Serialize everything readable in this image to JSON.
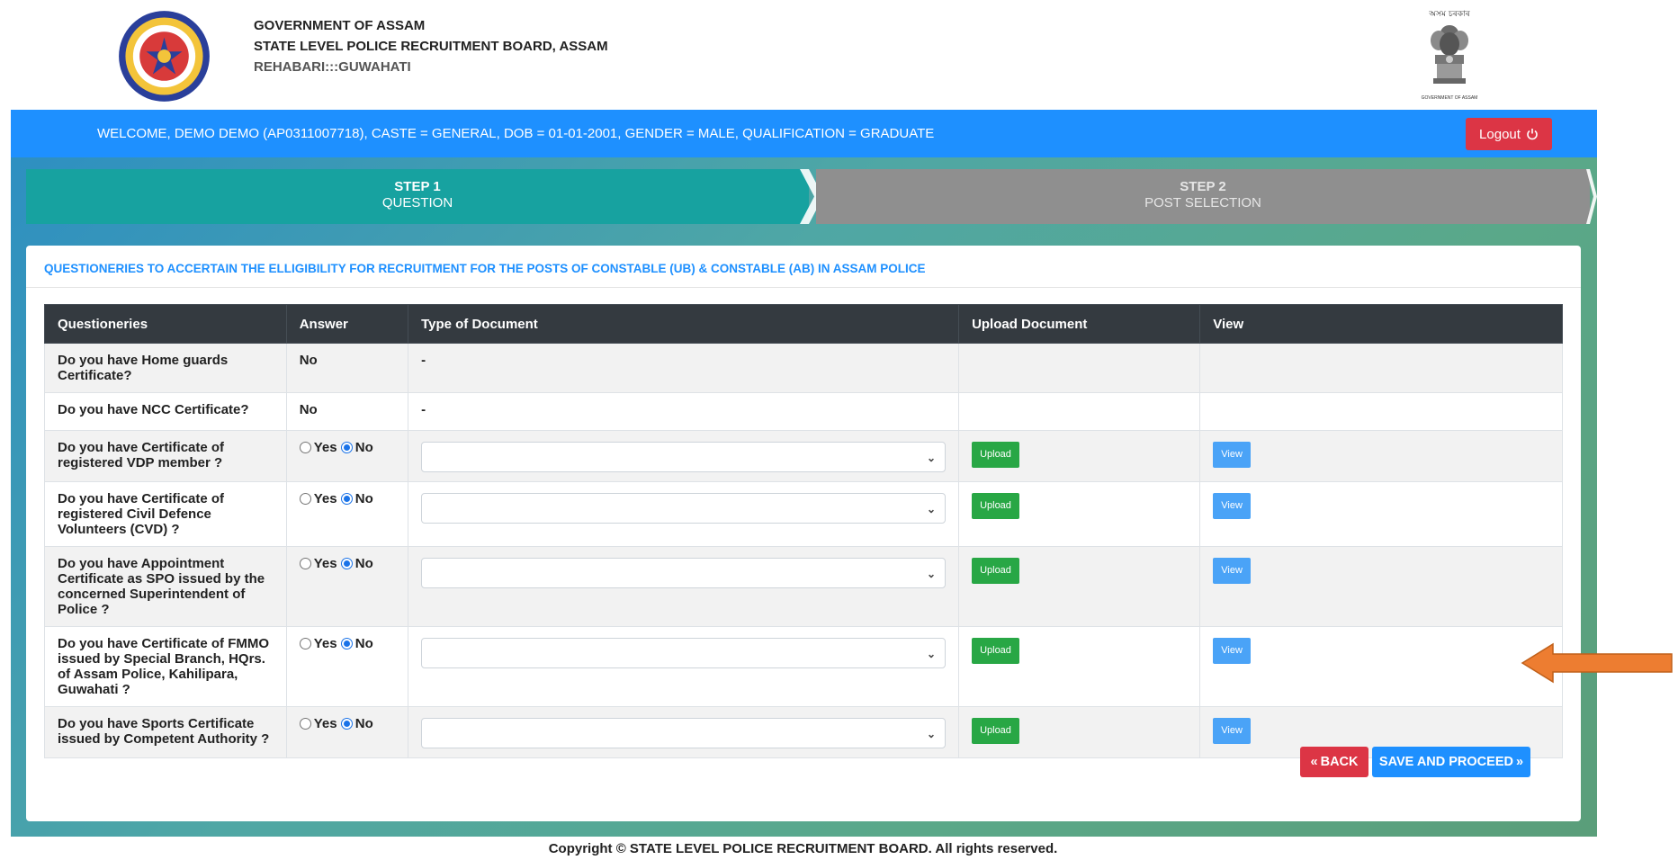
{
  "header": {
    "line1": "GOVERNMENT OF ASSAM",
    "line2": "STATE LEVEL POLICE RECRUITMENT BOARD, ASSAM",
    "line3": "REHABARI:::GUWAHATI",
    "emblem_top_text": "অসম চৰকাৰ",
    "emblem_bottom_text": "GOVERNMENT OF ASSAM",
    "logo_icon": "assam-police-logo",
    "emblem_icon": "national-emblem"
  },
  "welcome": {
    "text": "WELCOME, DEMO DEMO (AP0311007718), CASTE = GENERAL, DOB = 01-01-2001, GENDER = MALE, QUALIFICATION = GRADUATE",
    "logout_label": "Logout",
    "logout_icon": "power-icon"
  },
  "steps": [
    {
      "title": "STEP 1",
      "subtitle": "QUESTION"
    },
    {
      "title": "STEP 2",
      "subtitle": "POST SELECTION"
    }
  ],
  "card": {
    "title": "QUESTIONERIES TO ACCERTAIN THE ELLIGIBILITY FOR RECRUITMENT FOR THE POSTS OF CONSTABLE (UB) & CONSTABLE (AB) IN ASSAM POLICE"
  },
  "table": {
    "headers": [
      "Questioneries",
      "Answer",
      "Type of Document",
      "Upload Document",
      "View"
    ],
    "rows": [
      {
        "question": "Do you have Home guards Certificate?",
        "answer": "No",
        "document": "-"
      },
      {
        "question": "Do you have NCC Certificate?",
        "answer": "No",
        "document": "-"
      },
      {
        "question": "Do you have Certificate of registered VDP member ?",
        "yes": "Yes",
        "no": "No",
        "selected": "No",
        "upload": "Upload",
        "view": "View"
      },
      {
        "question": "Do you have Certificate of registered Civil Defence Volunteers (CVD) ?",
        "yes": "Yes",
        "no": "No",
        "selected": "No",
        "upload": "Upload",
        "view": "View"
      },
      {
        "question": "Do you have Appointment Certificate as SPO issued by the concerned Superintendent of Police ?",
        "yes": "Yes",
        "no": "No",
        "selected": "No",
        "upload": "Upload",
        "view": "View"
      },
      {
        "question": "Do you have Certificate of FMMO issued by Special Branch, HQrs. of Assam Police, Kahilipara, Guwahati ?",
        "yes": "Yes",
        "no": "No",
        "selected": "No",
        "upload": "Upload",
        "view": "View"
      },
      {
        "question": "Do you have Sports Certificate issued by Competent Authority ?",
        "yes": "Yes",
        "no": "No",
        "selected": "No",
        "upload": "Upload",
        "view": "View"
      }
    ]
  },
  "actions": {
    "back_label": "BACK",
    "save_label": "SAVE AND PROCEED",
    "back_icon": "double-chevron-left-icon",
    "save_icon": "double-chevron-right-icon"
  },
  "footer": {
    "text": "Copyright © STATE LEVEL POLICE RECRUITMENT BOARD. All rights reserved."
  },
  "colors": {
    "primary": "#1e90ff",
    "danger": "#dc3545",
    "success": "#28a745",
    "step_active": "#17a2a0",
    "step_inactive": "#8f8f8f",
    "table_header": "#343a40",
    "annotation_arrow": "#ed7d31"
  }
}
